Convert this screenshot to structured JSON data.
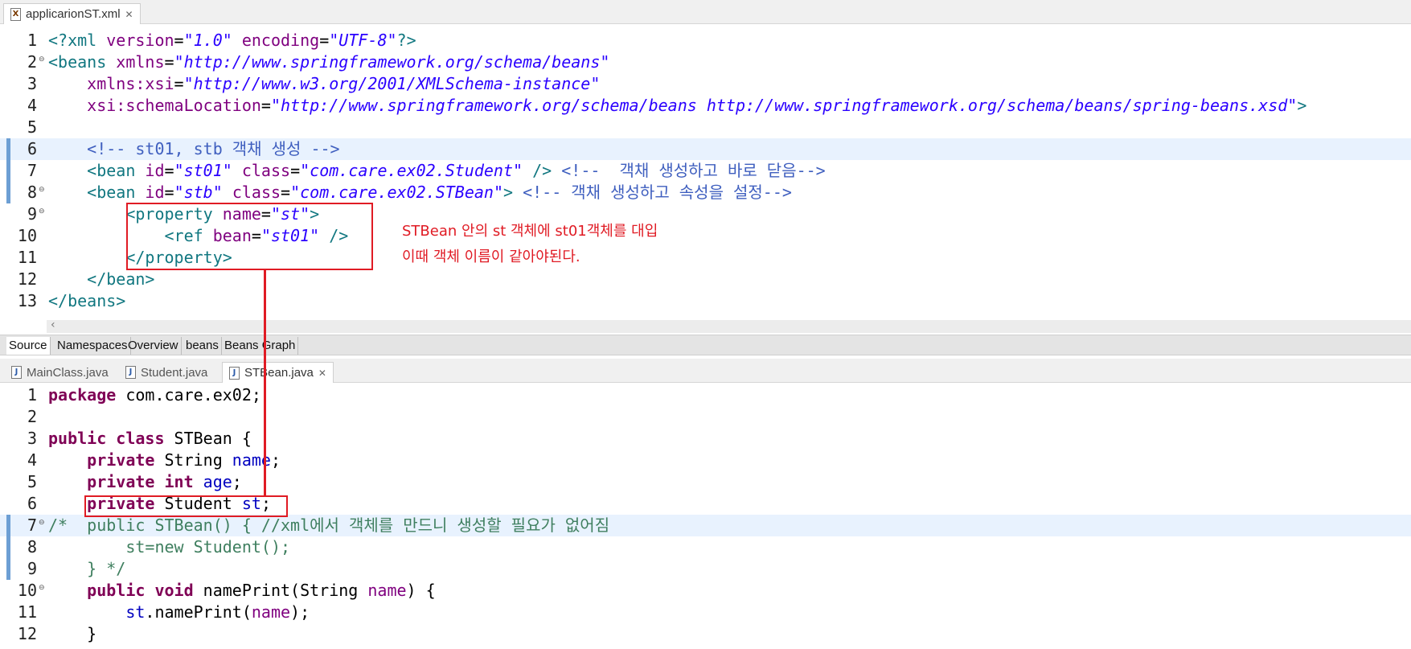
{
  "xml_editor": {
    "tab": {
      "label": "applicarionST.xml",
      "icon": "xml-file-icon"
    },
    "lines": [
      {
        "num": "1",
        "tokens": [
          [
            "t-tag",
            "<?xml "
          ],
          [
            "t-attr",
            "version"
          ],
          [
            "",
            "="
          ],
          [
            "t-val",
            "\"1.0\""
          ],
          [
            "t-attr",
            " encoding"
          ],
          [
            "",
            "="
          ],
          [
            "t-val",
            "\"UTF-8\""
          ],
          [
            "t-tag",
            "?>"
          ]
        ]
      },
      {
        "num": "2",
        "fold": true,
        "tokens": [
          [
            "t-tag",
            "<beans "
          ],
          [
            "t-attr",
            "xmlns"
          ],
          [
            "",
            "="
          ],
          [
            "t-val",
            "\"http://www.springframework.org/schema/beans\""
          ]
        ]
      },
      {
        "num": "3",
        "tokens": [
          [
            "",
            "    "
          ],
          [
            "t-attr",
            "xmlns:xsi"
          ],
          [
            "",
            "="
          ],
          [
            "t-val",
            "\"http://www.w3.org/2001/XMLSchema-instance\""
          ]
        ]
      },
      {
        "num": "4",
        "tokens": [
          [
            "",
            "    "
          ],
          [
            "t-attr",
            "xsi:schemaLocation"
          ],
          [
            "",
            "="
          ],
          [
            "t-val",
            "\"http://www.springframework.org/schema/beans http://www.springframework.org/schema/beans/spring-beans.xsd\""
          ],
          [
            "t-tag",
            ">"
          ]
        ]
      },
      {
        "num": "5",
        "tokens": []
      },
      {
        "num": "6",
        "current": true,
        "ruler": true,
        "tokens": [
          [
            "",
            "    "
          ],
          [
            "t-com",
            "<!-- st01, stb 객채 생성 -->"
          ]
        ]
      },
      {
        "num": "7",
        "ruler": true,
        "tokens": [
          [
            "",
            "    "
          ],
          [
            "t-tag",
            "<bean "
          ],
          [
            "t-attr",
            "id"
          ],
          [
            "",
            "="
          ],
          [
            "t-val",
            "\"st01\""
          ],
          [
            "t-attr",
            " class"
          ],
          [
            "",
            "="
          ],
          [
            "t-val",
            "\"com.care.ex02.Student\""
          ],
          [
            "t-tag",
            " />"
          ],
          [
            "",
            " "
          ],
          [
            "t-com",
            "<!--  객채 생성하고 바로 닫음-->"
          ]
        ]
      },
      {
        "num": "8",
        "fold": true,
        "ruler": true,
        "tokens": [
          [
            "",
            "    "
          ],
          [
            "t-tag",
            "<bean "
          ],
          [
            "t-attr",
            "id"
          ],
          [
            "",
            "="
          ],
          [
            "t-val",
            "\"stb\""
          ],
          [
            "t-attr",
            " class"
          ],
          [
            "",
            "="
          ],
          [
            "t-val",
            "\"com.care.ex02.STBean\""
          ],
          [
            "t-tag",
            ">"
          ],
          [
            "",
            " "
          ],
          [
            "t-com",
            "<!-- 객채 생성하고 속성을 설정-->"
          ]
        ]
      },
      {
        "num": "9",
        "fold": true,
        "tokens": [
          [
            "",
            "        "
          ],
          [
            "t-tag",
            "<property "
          ],
          [
            "t-attr",
            "name"
          ],
          [
            "",
            "="
          ],
          [
            "t-val",
            "\"st\""
          ],
          [
            "t-tag",
            ">"
          ]
        ]
      },
      {
        "num": "10",
        "tokens": [
          [
            "",
            "            "
          ],
          [
            "t-tag",
            "<ref "
          ],
          [
            "t-attr",
            "bean"
          ],
          [
            "",
            "="
          ],
          [
            "t-val",
            "\"st01\""
          ],
          [
            "t-tag",
            " />"
          ]
        ]
      },
      {
        "num": "11",
        "tokens": [
          [
            "",
            "        "
          ],
          [
            "t-tag",
            "</property>"
          ]
        ]
      },
      {
        "num": "12",
        "tokens": [
          [
            "",
            "    "
          ],
          [
            "t-tag",
            "</bean>"
          ]
        ]
      },
      {
        "num": "13",
        "tokens": [
          [
            "t-tag",
            "</beans>"
          ]
        ]
      }
    ],
    "bottom_tabs": [
      "Source",
      "Namespaces",
      "Overview",
      "beans",
      "Beans Graph"
    ],
    "active_bottom_tab": "Source"
  },
  "java_editor": {
    "tabs": [
      {
        "label": "MainClass.java",
        "active": false,
        "icon": "java-file-icon"
      },
      {
        "label": "Student.java",
        "active": false,
        "icon": "java-file-icon"
      },
      {
        "label": "STBean.java",
        "active": true,
        "icon": "java-file-icon"
      }
    ],
    "lines": [
      {
        "num": "1",
        "tokens": [
          [
            "t-kw",
            "package"
          ],
          [
            "",
            " com.care.ex02;"
          ]
        ]
      },
      {
        "num": "2",
        "tokens": []
      },
      {
        "num": "3",
        "tokens": [
          [
            "t-kw",
            "public class"
          ],
          [
            "",
            " STBean {"
          ]
        ]
      },
      {
        "num": "4",
        "tokens": [
          [
            "",
            "    "
          ],
          [
            "t-kw",
            "private"
          ],
          [
            "",
            " String "
          ],
          [
            "t-field",
            "name"
          ],
          [
            "",
            ";"
          ]
        ]
      },
      {
        "num": "5",
        "tokens": [
          [
            "",
            "    "
          ],
          [
            "t-kw",
            "private int"
          ],
          [
            "",
            " "
          ],
          [
            "t-field",
            "age"
          ],
          [
            "",
            ";"
          ]
        ]
      },
      {
        "num": "6",
        "tokens": [
          [
            "",
            "    "
          ],
          [
            "t-kw",
            "private"
          ],
          [
            "",
            " Student "
          ],
          [
            "t-field",
            "st"
          ],
          [
            "",
            ";"
          ]
        ]
      },
      {
        "num": "7",
        "fold": true,
        "current": true,
        "ruler": true,
        "tokens": [
          [
            "t-jcom",
            "/*  public STBean() { //xml에서 객체를 만드니 생성할 필요가 없어짐"
          ]
        ]
      },
      {
        "num": "8",
        "ruler": true,
        "tokens": [
          [
            "t-jcom",
            "        st=new Student();"
          ]
        ]
      },
      {
        "num": "9",
        "ruler": true,
        "tokens": [
          [
            "t-jcom",
            "    } */"
          ]
        ]
      },
      {
        "num": "10",
        "fold": true,
        "tokens": [
          [
            "",
            "    "
          ],
          [
            "t-kw",
            "public void"
          ],
          [
            "",
            " namePrint(String "
          ],
          [
            "t-attr",
            "name"
          ],
          [
            "",
            ") {"
          ]
        ]
      },
      {
        "num": "11",
        "tokens": [
          [
            "",
            "        "
          ],
          [
            "t-field",
            "st"
          ],
          [
            "",
            ".namePrint("
          ],
          [
            "t-attr",
            "name"
          ],
          [
            "",
            ");"
          ]
        ]
      },
      {
        "num": "12",
        "tokens": [
          [
            "",
            "    }"
          ]
        ]
      }
    ]
  },
  "annotation": {
    "line1": "STBean 안의 st 객체에 st01객체를 대입",
    "line2": "이때 객체 이름이 같아야된다."
  },
  "colors": {
    "highlight": "#e01b24",
    "current_line": "#e8f2fe",
    "ruler": "#6d9fd4"
  }
}
